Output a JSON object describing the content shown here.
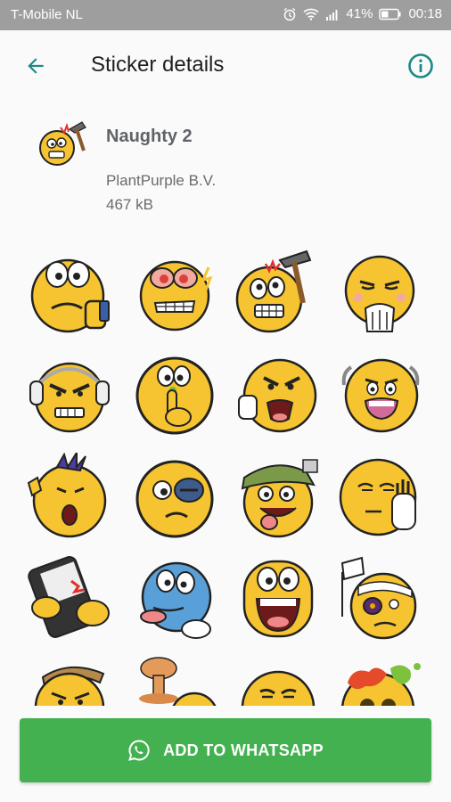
{
  "status_bar": {
    "carrier": "T-Mobile  NL",
    "battery": "41%",
    "time": "00:18"
  },
  "toolbar": {
    "title": "Sticker details",
    "back_icon": "arrow-back-icon",
    "info_icon": "info-icon"
  },
  "pack": {
    "name": "Naughty 2",
    "publisher": "PlantPurple B.V.",
    "size": "467 kB"
  },
  "colors": {
    "accent": "#1a8a84",
    "button_green": "#43b14f",
    "sticker_yellow": "#f6c431",
    "sticker_blue": "#5aa0d8"
  },
  "stickers": [
    "thumbs-down-frown",
    "angry-red-eyes",
    "hammer-head",
    "giggle-hand",
    "headphones-angry",
    "nose-pick",
    "angry-shout",
    "old-man-yell",
    "punk-rocker",
    "black-eye",
    "cap-tongue",
    "talk-to-hand",
    "phone-smash",
    "blue-tongue",
    "big-mouth",
    "bandaged-flag",
    "bird-nest",
    "nuclear-cloud",
    "grumpy",
    "paint-splat"
  ],
  "bottom": {
    "button_label": "ADD TO WHATSAPP",
    "button_icon": "whatsapp-icon"
  }
}
